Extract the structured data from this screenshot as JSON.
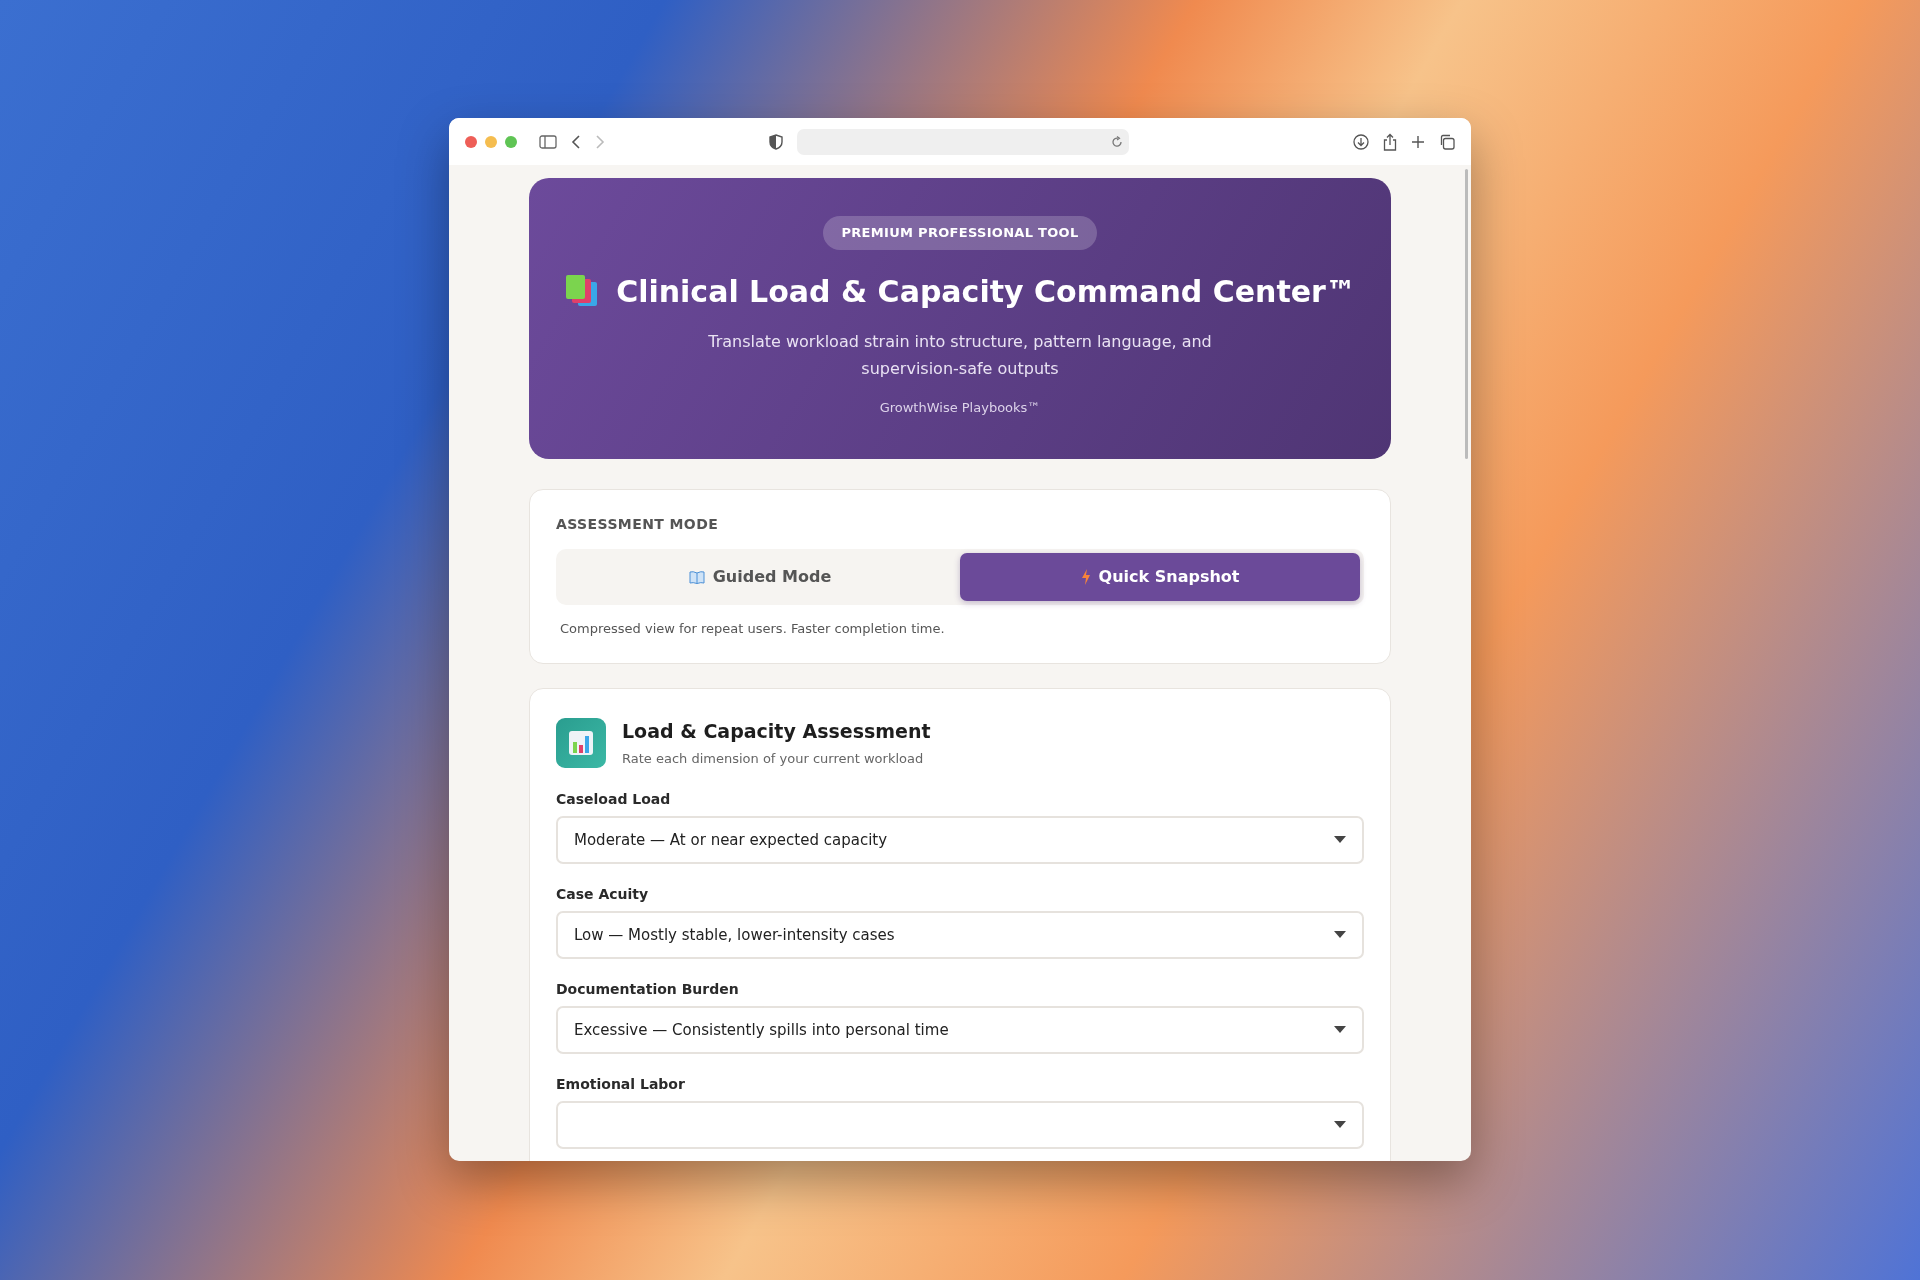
{
  "hero": {
    "badge": "PREMIUM PROFESSIONAL TOOL",
    "title": "Clinical Load & Capacity Command Center™",
    "subtitle": "Translate workload strain into structure, pattern language, and supervision-safe outputs",
    "brand": "GrowthWise Playbooks™"
  },
  "mode": {
    "heading": "ASSESSMENT MODE",
    "options": [
      {
        "label": "Guided Mode",
        "selected": false
      },
      {
        "label": "Quick Snapshot",
        "selected": true
      }
    ],
    "description": "Compressed view for repeat users. Faster completion time."
  },
  "assessment": {
    "title": "Load & Capacity Assessment",
    "subtitle": "Rate each dimension of your current workload",
    "fields": [
      {
        "label": "Caseload Load",
        "value": "Moderate — At or near expected capacity"
      },
      {
        "label": "Case Acuity",
        "value": "Low — Mostly stable, lower-intensity cases"
      },
      {
        "label": "Documentation Burden",
        "value": "Excessive — Consistently spills into personal time"
      },
      {
        "label": "Emotional Labor"
      }
    ]
  }
}
